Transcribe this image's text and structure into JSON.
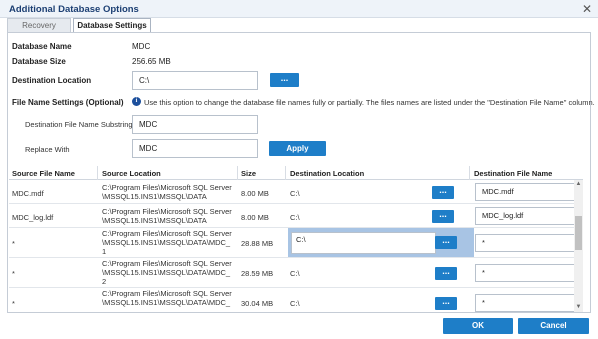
{
  "window": {
    "title": "Additional Database Options",
    "close_symbol": "✕"
  },
  "tabs": [
    {
      "label": "Recovery Options",
      "active": false
    },
    {
      "label": "Database Settings",
      "active": true
    }
  ],
  "database": {
    "name_label": "Database Name",
    "name_value": "MDC",
    "size_label": "Database Size",
    "size_value": "256.65 MB",
    "destination_label": "Destination Location",
    "destination_value": "C:\\",
    "browse_label": "..."
  },
  "file_name_settings": {
    "heading": "File Name Settings (Optional)",
    "info_icon": "i",
    "info_text": "Use this option to change the database file names fully or partially. The files names are listed under the \"Destination File Name\" column.",
    "substring_label": "Destination File Name Substring",
    "substring_value": "MDC",
    "replace_label": "Replace With",
    "replace_value": "MDC",
    "apply_label": "Apply"
  },
  "grid": {
    "columns": [
      "Source File Name",
      "Source Location",
      "Size",
      "Destination Location",
      "Destination File Name"
    ],
    "rows": [
      {
        "source_file": "MDC.mdf",
        "source_location": [
          "C:\\Program Files\\Microsoft SQL Server",
          "\\MSSQL15.INS1\\MSSQL\\DATA"
        ],
        "size": "8.00 MB",
        "dest_location": "C:\\",
        "browse": "...",
        "dest_file": "MDC.mdf"
      },
      {
        "source_file": "MDC_log.ldf",
        "source_location": [
          "C:\\Program Files\\Microsoft SQL Server",
          "\\MSSQL15.INS1\\MSSQL\\DATA"
        ],
        "size": "8.00 MB",
        "dest_location": "C:\\",
        "browse": "...",
        "dest_file": "MDC_log.ldf"
      },
      {
        "source_file": "*",
        "source_location": [
          "C:\\Program Files\\Microsoft SQL Server",
          "\\MSSQL15.INS1\\MSSQL\\DATA\\MDC_",
          "1"
        ],
        "size": "28.88 MB",
        "dest_location": "C:\\",
        "browse": "...",
        "dest_file": "*"
      },
      {
        "source_file": "*",
        "source_location": [
          "C:\\Program Files\\Microsoft SQL Server",
          "\\MSSQL15.INS1\\MSSQL\\DATA\\MDC_",
          "2"
        ],
        "size": "28.59 MB",
        "dest_location": "C:\\",
        "browse": "...",
        "dest_file": "*"
      },
      {
        "source_file": "*",
        "source_location": [
          "C:\\Program Files\\Microsoft SQL Server",
          "\\MSSQL15.INS1\\MSSQL\\DATA\\MDC_"
        ],
        "size": "30.04 MB",
        "dest_location": "C:\\",
        "browse": "...",
        "dest_file": "*"
      }
    ],
    "scroll_up": "▲",
    "scroll_down": "▼"
  },
  "footer": {
    "ok_label": "OK",
    "cancel_label": "Cancel"
  },
  "colors": {
    "accent": "#1e7ec8",
    "title": "#1c3f73",
    "selection": "#a8c4e4"
  }
}
